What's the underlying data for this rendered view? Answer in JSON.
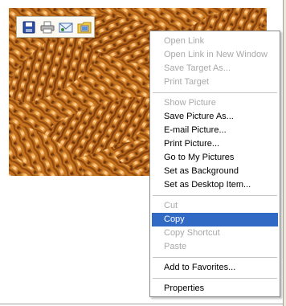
{
  "toolbar": {
    "icons": [
      "save-icon",
      "print-icon",
      "email-icon",
      "my-pictures-icon"
    ]
  },
  "context_menu": {
    "items": [
      {
        "label": "Open Link",
        "enabled": false
      },
      {
        "label": "Open Link in New Window",
        "enabled": false
      },
      {
        "label": "Save Target As...",
        "enabled": false
      },
      {
        "label": "Print Target",
        "enabled": false
      },
      {
        "label": "Show Picture",
        "enabled": false
      },
      {
        "label": "Save Picture As...",
        "enabled": true
      },
      {
        "label": "E-mail Picture...",
        "enabled": true
      },
      {
        "label": "Print Picture...",
        "enabled": true
      },
      {
        "label": "Go to My Pictures",
        "enabled": true
      },
      {
        "label": "Set as Background",
        "enabled": true
      },
      {
        "label": "Set as Desktop Item...",
        "enabled": true
      },
      {
        "label": "Cut",
        "enabled": false
      },
      {
        "label": "Copy",
        "enabled": true,
        "highlighted": true
      },
      {
        "label": "Copy Shortcut",
        "enabled": false
      },
      {
        "label": "Paste",
        "enabled": false
      },
      {
        "label": "Add to Favorites...",
        "enabled": true
      },
      {
        "label": "Properties",
        "enabled": true
      }
    ]
  },
  "colors": {
    "highlight": "#316ac5",
    "disabled_text": "#a9a9a9",
    "pasta_orange": "#d98b33"
  }
}
